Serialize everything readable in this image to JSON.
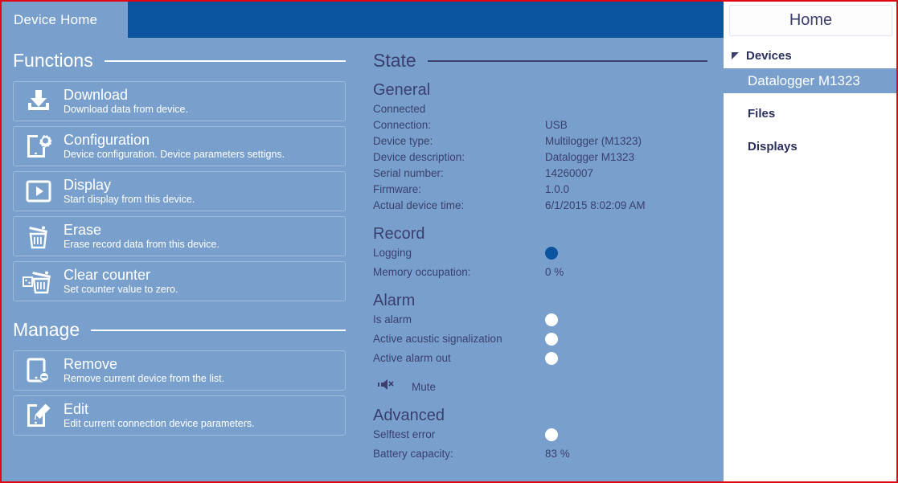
{
  "window": {
    "border_color": "#e20613"
  },
  "tabs": [
    {
      "label": "Device Home",
      "active": true
    }
  ],
  "colors": {
    "panel_bg": "#79a0cc",
    "tabbar_bg": "#0b539f",
    "accent": "#0b539f",
    "text_dark": "#3a3f6e",
    "text_light": "#ffffff"
  },
  "left": {
    "functions_heading": "Functions",
    "functions": [
      {
        "icon": "download-icon",
        "title": "Download",
        "subtitle": "Download data from device."
      },
      {
        "icon": "configuration-icon",
        "title": "Configuration",
        "subtitle": "Device configuration. Device parameters settigns."
      },
      {
        "icon": "display-icon",
        "title": "Display",
        "subtitle": "Start display from this device."
      },
      {
        "icon": "erase-icon",
        "title": "Erase",
        "subtitle": "Erase record data from this device."
      },
      {
        "icon": "clear-counter-icon",
        "title": "Clear counter",
        "subtitle": "Set counter value to zero."
      }
    ],
    "manage_heading": "Manage",
    "manage": [
      {
        "icon": "remove-device-icon",
        "title": "Remove",
        "subtitle": "Remove current device from the list."
      },
      {
        "icon": "edit-device-icon",
        "title": "Edit",
        "subtitle": "Edit current connection device parameters."
      }
    ]
  },
  "state": {
    "heading": "State",
    "general": {
      "heading": "General",
      "connected_label": "Connected",
      "rows": [
        {
          "label": "Connection:",
          "value": "USB"
        },
        {
          "label": "Device type:",
          "value": "Multilogger (M1323)"
        },
        {
          "label": "Device description:",
          "value": "Datalogger M1323"
        },
        {
          "label": "Serial number:",
          "value": "14260007"
        },
        {
          "label": "Firmware:",
          "value": "1.0.0"
        },
        {
          "label": "Actual device time:",
          "value": "6/1/2015 8:02:09 AM"
        }
      ]
    },
    "record": {
      "heading": "Record",
      "logging_label": "Logging",
      "logging_on": true,
      "memory_label": "Memory occupation:",
      "memory_value": "0 %",
      "memory_percent": 0
    },
    "alarm": {
      "heading": "Alarm",
      "indicators": [
        {
          "label": "Is alarm",
          "on": false
        },
        {
          "label": "Active acustic signalization",
          "on": false
        },
        {
          "label": "Active alarm out",
          "on": false
        }
      ],
      "mute_icon": "mute-speaker-icon",
      "mute_label": "Mute"
    },
    "advanced": {
      "heading": "Advanced",
      "selftest_label": "Selftest error",
      "selftest_on": false,
      "battery_label": "Battery capacity:",
      "battery_value": "83 %",
      "battery_percent": 83
    }
  },
  "sidebar": {
    "home_label": "Home",
    "group_label": "Devices",
    "group_icon": "triangle-collapse-icon",
    "items": [
      {
        "label": "Datalogger M1323",
        "selected": true
      },
      {
        "label": "Files",
        "selected": false
      },
      {
        "label": "Displays",
        "selected": false
      }
    ]
  }
}
